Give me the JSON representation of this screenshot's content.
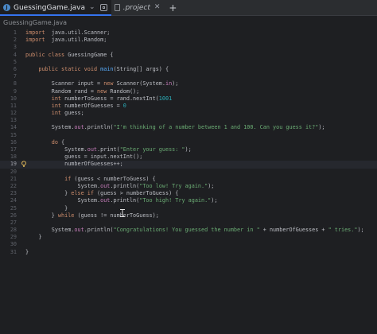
{
  "tabs": [
    {
      "label": "GuessingGame.java",
      "active": true
    },
    {
      "label": ".project",
      "active": false
    }
  ],
  "breadcrumb": "GuessingGame.java",
  "colors": {
    "keyword": "#cf8e6d",
    "string": "#6aab73",
    "number": "#2aacb8",
    "field": "#c77dbb",
    "method": "#56a8f5",
    "accent": "#3574f0"
  },
  "icons": [
    "java-file-icon",
    "chevron-down-icon",
    "split-view-icon",
    "close-icon",
    "file-icon",
    "add-icon",
    "lightbulb-icon",
    "text-cursor-icon"
  ],
  "editor": {
    "current_line": 19,
    "lines": [
      {
        "n": "1",
        "t": [
          [
            "kw",
            "import"
          ],
          [
            "",
            "  java.util.Scanner;"
          ]
        ]
      },
      {
        "n": "2",
        "t": [
          [
            "kw",
            "import"
          ],
          [
            "",
            "  java.util.Random;"
          ]
        ]
      },
      {
        "n": "3",
        "t": []
      },
      {
        "n": "4",
        "t": [
          [
            "kw",
            "public class"
          ],
          [
            "",
            " GuessingGame {"
          ]
        ]
      },
      {
        "n": "5",
        "t": []
      },
      {
        "n": "6",
        "t": [
          [
            "",
            "    "
          ],
          [
            "kw",
            "public static void"
          ],
          [
            "",
            " "
          ],
          [
            "fn",
            "main"
          ],
          [
            "",
            "(String[] args) {"
          ]
        ]
      },
      {
        "n": "7",
        "t": []
      },
      {
        "n": "8",
        "t": [
          [
            "",
            "        Scanner input = "
          ],
          [
            "kw",
            "new"
          ],
          [
            "",
            " Scanner(System."
          ],
          [
            "fld",
            "in"
          ],
          [
            "",
            ");"
          ]
        ]
      },
      {
        "n": "9",
        "t": [
          [
            "",
            "        Random rand = "
          ],
          [
            "kw",
            "new"
          ],
          [
            "",
            " Random();"
          ]
        ]
      },
      {
        "n": "10",
        "t": [
          [
            "",
            "        "
          ],
          [
            "kw",
            "int"
          ],
          [
            "",
            " numberToGuess = rand.nextInt("
          ],
          [
            "num",
            "100"
          ],
          [
            ") + "
          ],
          [
            "num",
            "1"
          ],
          [
            ";"
          ]
        ]
      },
      {
        "n": "11",
        "t": [
          [
            "",
            "        "
          ],
          [
            "kw",
            "int"
          ],
          [
            "",
            " numberOfGuesses = "
          ],
          [
            "num",
            "0"
          ],
          [
            ";"
          ]
        ]
      },
      {
        "n": "12",
        "t": [
          [
            "",
            "        "
          ],
          [
            "kw",
            "int"
          ],
          [
            "",
            " guess;"
          ]
        ]
      },
      {
        "n": "13",
        "t": []
      },
      {
        "n": "14",
        "t": [
          [
            "",
            "        System."
          ],
          [
            "fld",
            "out"
          ],
          [
            "",
            ".println("
          ],
          [
            "str",
            "\"I'm thinking of a number between 1 and 100. Can you guess it?\""
          ],
          [
            "",
            ");"
          ]
        ]
      },
      {
        "n": "15",
        "t": []
      },
      {
        "n": "16",
        "t": [
          [
            "",
            "        "
          ],
          [
            "kw",
            "do"
          ],
          [
            "",
            " {"
          ]
        ]
      },
      {
        "n": "17",
        "t": [
          [
            "",
            "            System."
          ],
          [
            "fld",
            "out"
          ],
          [
            "",
            ".print("
          ],
          [
            "str",
            "\"Enter your guess: \""
          ],
          [
            "",
            ");"
          ]
        ]
      },
      {
        "n": "18",
        "t": [
          [
            "",
            "            guess = input.nextInt();"
          ]
        ]
      },
      {
        "n": "19",
        "t": [
          [
            "",
            "            numberOfGuesses++;"
          ]
        ]
      },
      {
        "n": "20",
        "t": []
      },
      {
        "n": "21",
        "t": [
          [
            "",
            "            "
          ],
          [
            "kw",
            "if"
          ],
          [
            "",
            " (guess < numberToGuess) {"
          ]
        ]
      },
      {
        "n": "22",
        "t": [
          [
            "",
            "                System."
          ],
          [
            "fld",
            "out"
          ],
          [
            "",
            ".println("
          ],
          [
            "str",
            "\"Too low! Try again.\""
          ],
          [
            "",
            ");"
          ]
        ]
      },
      {
        "n": "23",
        "t": [
          [
            "",
            "            } "
          ],
          [
            "kw",
            "else if"
          ],
          [
            "",
            " (guess > numberToGuess) {"
          ]
        ]
      },
      {
        "n": "24",
        "t": [
          [
            "",
            "                System."
          ],
          [
            "fld",
            "out"
          ],
          [
            "",
            ".println("
          ],
          [
            "str",
            "\"Too high! Try again.\""
          ],
          [
            "",
            ");"
          ]
        ]
      },
      {
        "n": "25",
        "t": [
          [
            "",
            "            }"
          ]
        ]
      },
      {
        "n": "26",
        "t": [
          [
            "",
            "        } "
          ],
          [
            "kw",
            "while"
          ],
          [
            "",
            " (guess != numberToGuess);"
          ]
        ]
      },
      {
        "n": "27",
        "t": []
      },
      {
        "n": "28",
        "t": [
          [
            "",
            "        System."
          ],
          [
            "fld",
            "out"
          ],
          [
            "",
            ".println("
          ],
          [
            "str",
            "\"Congratulations! You guessed the number in \""
          ],
          [
            "",
            " + numberOfGuesses + "
          ],
          [
            "str",
            "\" tries.\""
          ],
          [
            "",
            ");"
          ]
        ]
      },
      {
        "n": "29",
        "t": [
          [
            "",
            "    }"
          ]
        ]
      },
      {
        "n": "30",
        "t": []
      },
      {
        "n": "31",
        "t": [
          [
            "",
            "}"
          ]
        ]
      }
    ]
  }
}
